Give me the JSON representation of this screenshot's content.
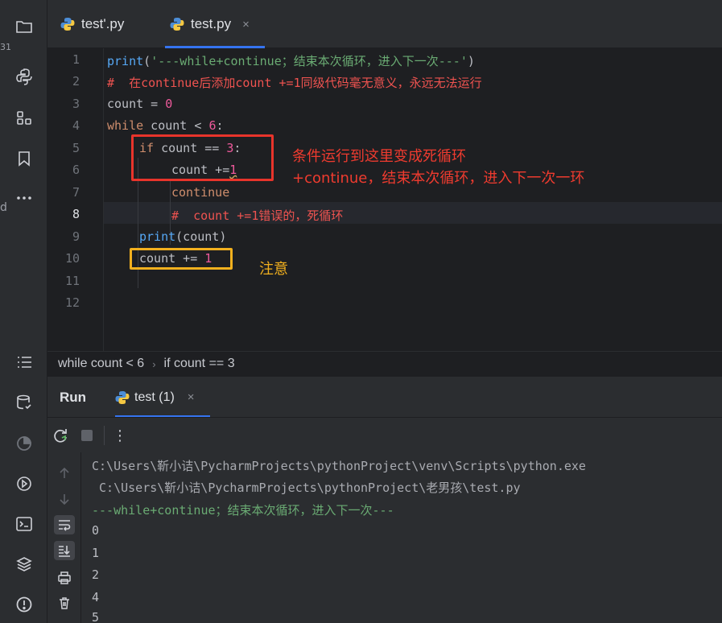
{
  "colors": {
    "keyword": "#cf8e6d",
    "string": "#6aab73",
    "number": "#2aacb8",
    "comment": "#7a7e85",
    "annotation_red": "#ef3b2f",
    "annotation_yellow": "#f2b01e",
    "accent": "#3574f0"
  },
  "sidebar": {
    "icons": [
      "folder-icon",
      "python-packages-icon",
      "structure-icon",
      "bookmarks-icon",
      "more-icon",
      "todo-list-icon",
      "database-icon",
      "coverage-icon",
      "services-icon",
      "terminal-icon",
      "layers-icon",
      "problems-icon"
    ],
    "edge_glyphs": [
      "31",
      "d"
    ]
  },
  "tabs": [
    {
      "label": "test'.py",
      "active": false
    },
    {
      "label": "test.py",
      "active": true,
      "close": "×"
    }
  ],
  "editor": {
    "line_numbers": [
      "1",
      "2",
      "3",
      "4",
      "5",
      "6",
      "7",
      "8",
      "9",
      "10",
      "11",
      "12"
    ],
    "lines": {
      "l1_func": "print",
      "l1_open": "(",
      "l1_str": "'---while+continue；结束本次循环，进入下一次---'",
      "l1_close": ")",
      "l2": "#  在continue后添加count +=1同级代码毫无意义，永远无法运行",
      "l3_a": "count = ",
      "l3_num": "0",
      "l4_kw": "while",
      "l4_a": " count < ",
      "l4_num": "6",
      "l4_b": ":",
      "l5_kw": "if",
      "l5_a": " count == ",
      "l5_num": "3",
      "l5_b": ":",
      "l6_a": "count +=",
      "l6_num": "1",
      "l7_kw": "continue",
      "l8": "#  count +=1错误的，死循环",
      "l9_func": "print",
      "l9_a": "(count)",
      "l10_a": "count += ",
      "l10_num": "1"
    },
    "annotations": {
      "red_line1": "条件运行到这里变成死循环",
      "red_line2": "+continue，结束本次循环，进入下一次一环",
      "yellow": "注意"
    }
  },
  "breadcrumb": {
    "items": [
      "while count < 6",
      "if count == 3"
    ],
    "separator": "›"
  },
  "run": {
    "title": "Run",
    "tab_label": "test (1)",
    "tab_close": "×",
    "tools": {
      "more": "⋮"
    }
  },
  "console": {
    "lines": [
      "C:\\Users\\靳小诘\\PycharmProjects\\pythonProject\\venv\\Scripts\\python.exe",
      " C:\\Users\\靳小诘\\PycharmProjects\\pythonProject\\老男孩\\test.py",
      "---while+continue；结束本次循环，进入下一次---",
      "0",
      "1",
      "2",
      "4",
      "5"
    ]
  }
}
